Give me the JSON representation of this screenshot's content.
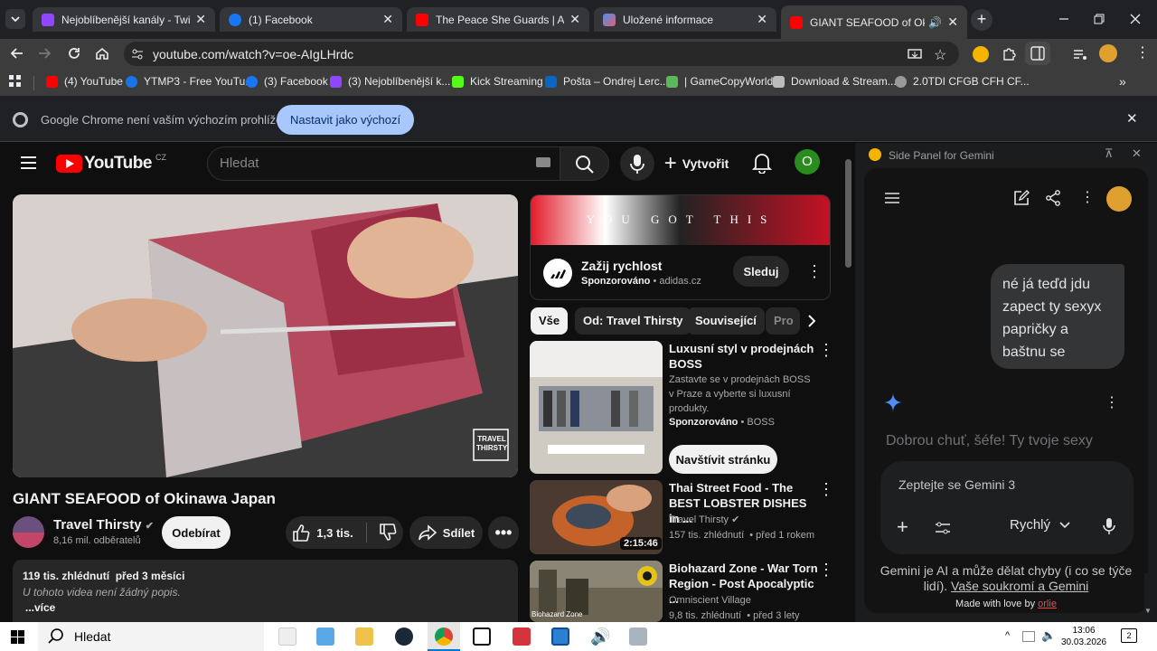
{
  "colors": {
    "accent_blue": "#a8c7fa",
    "yt_red": "#ff0000",
    "avatar_green": "#2a8c1f",
    "gemini_blue": "#4c8df6"
  },
  "tabs": [
    {
      "title": "Nejoblíbenější kanály - Twitch",
      "icon": "twitch-icon",
      "color": "#9146ff"
    },
    {
      "title": "(1) Facebook",
      "icon": "facebook-icon",
      "color": "#1877f2"
    },
    {
      "title": "The Peace She Guards | Ambien",
      "icon": "youtube-icon",
      "color": "#ff0000"
    },
    {
      "title": "Uložené informace",
      "icon": "gemini-icon",
      "color": "#4c8df6"
    },
    {
      "title": "GIANT SEAFOOD of Okinaw",
      "icon": "youtube-icon",
      "color": "#ff0000"
    }
  ],
  "url": "youtube.com/watch?v=oe-AIgLHrdc",
  "bookmarks": [
    {
      "label": "(4) YouTube",
      "color": "#ff0000"
    },
    {
      "label": "YTMP3 - Free YouTu...",
      "color": "#1a73e8"
    },
    {
      "label": "(3) Facebook",
      "color": "#1877f2"
    },
    {
      "label": "(3) Nejoblíbenější k...",
      "color": "#9146ff"
    },
    {
      "label": "Kick Streaming",
      "color": "#53fc18"
    },
    {
      "label": "Pošta – Ondrej Lerc...",
      "color": "#0a66c2"
    },
    {
      "label": "| GameCopyWorld",
      "color": "#5cb85c"
    },
    {
      "label": "Download & Stream...",
      "color": "#bbbbbb"
    },
    {
      "label": "2.0TDI CFGB CFH CF...",
      "color": "#999999"
    }
  ],
  "infobar": {
    "message": "Google Chrome není vaším výchozím prohlížečem",
    "button": "Nastavit jako výchozí"
  },
  "youtube": {
    "logo_text": "YouTube",
    "region": "CZ",
    "search_placeholder": "Hledat",
    "create_label": "Vytvořit",
    "avatar_letter": "O",
    "video_title": "GIANT SEAFOOD of Okinawa Japan",
    "watermark": "TRAVEL THIRSTY",
    "channel_name": "Travel Thirsty",
    "subscribers": "8,16 mil. odběratelů",
    "subscribe_label": "Odebírat",
    "likes": "1,3 tis.",
    "share_label": "Sdílet",
    "description": {
      "stats": "119 tis. zhlédnutí  před 3 měsíci",
      "text": "U tohoto videa není žádný popis.",
      "more": "...více"
    },
    "ad": {
      "banner_text": "YOU GOT THIS",
      "title": "Zažij rychlost",
      "sponsored": "Sponzorováno",
      "domain": "adidas.cz",
      "follow": "Sleduj"
    },
    "chips": [
      "Vše",
      "Od: Travel Thirsty",
      "Související",
      "Pro"
    ],
    "recs": [
      {
        "title": "Luxusní styl v prodejnách BOSS",
        "desc": "Zastavte se v prodejnách BOSS v Praze a vyberte si luxusní produkty.",
        "sponsored": "Sponzorováno",
        "advertiser": "BOSS",
        "cta": "Navštívit stránku"
      },
      {
        "title": "Thai Street Food - The BEST LOBSTER DISHES in ...",
        "channel": "Travel Thirsty",
        "meta": "157 tis. zhlédnutí  • před 1 rokem",
        "duration": "2:15:46"
      },
      {
        "title": "Biohazard Zone - War Torn Region - Post Apocalyptic ...",
        "channel": "Omniscient Village",
        "meta": "9,8 tis. zhlédnutí  • před 3 lety",
        "thumb_label": "Biohazard Zone"
      }
    ]
  },
  "gemini": {
    "panel_title": "Side Panel for Gemini",
    "user_message": "né já teďd jdu zapect ty sexyx papričky a baštnu se",
    "response": "Dobrou chuť, šéfe! Ty tvoje sexy",
    "input_placeholder": "Zeptejte se Gemini 3",
    "mode": "Rychlý",
    "disclaimer": "Gemini je AI a může dělat chyby (i co se týče lidí).",
    "privacy_link": "Vaše soukromí a Gemini",
    "made_with": "Made with love by",
    "author": "orlie"
  },
  "taskbar": {
    "search": "Hledat",
    "time": "13:06",
    "date": "30.03.2026",
    "notifications": "2"
  }
}
